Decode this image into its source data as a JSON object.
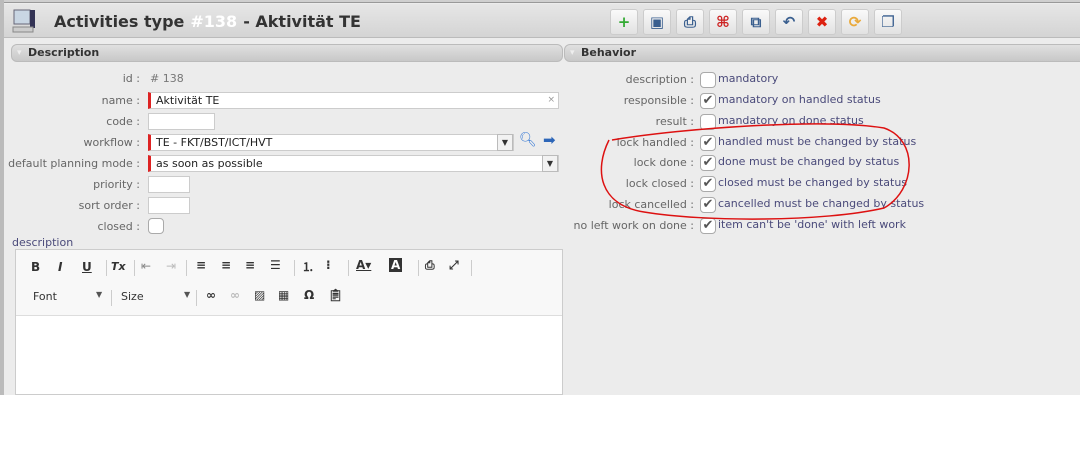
{
  "header": {
    "title": "Activities type",
    "id_label": "#138",
    "name_suffix": "- Aktivität TE"
  },
  "toolbar": [
    {
      "icon": "new-icon",
      "glyph": "+"
    },
    {
      "icon": "save-icon",
      "glyph": "▣"
    },
    {
      "icon": "print-icon",
      "glyph": "⎙"
    },
    {
      "icon": "pdf-icon",
      "glyph": "⌘"
    },
    {
      "icon": "copy-icon",
      "glyph": "⧉"
    },
    {
      "icon": "undo-icon",
      "glyph": "↶"
    },
    {
      "icon": "delete-icon",
      "glyph": "✖"
    },
    {
      "icon": "refresh-icon",
      "glyph": "⟳"
    },
    {
      "icon": "multi-window-icon",
      "glyph": "❐"
    }
  ],
  "description": {
    "section": "Description",
    "id_label": "id :",
    "id_value": "#  138",
    "name_label": "name :",
    "name_value": "Aktivität TE",
    "clear": "×",
    "code_label": "code :",
    "code_value": "",
    "workflow_label": "workflow :",
    "workflow_value": "TE - FKT/BST/ICT/HVT",
    "planning_label": "default planning mode :",
    "planning_value": "as soon as possible",
    "priority_label": "priority :",
    "sort_label": "sort order :",
    "closed_label": "closed :",
    "desc_label": "description"
  },
  "editor": {
    "font": "Font",
    "size": "Size",
    "b": "B",
    "i": "I",
    "u": "U",
    "tx": "Tx",
    "omega": "Ω"
  },
  "behavior": {
    "section": "Behavior",
    "rows": [
      {
        "label": "description :",
        "text": "mandatory",
        "checked": false
      },
      {
        "label": "responsible :",
        "text": "mandatory on handled status",
        "checked": true
      },
      {
        "label": "result :",
        "text": "mandatory on done status",
        "checked": false
      },
      {
        "label": "lock handled :",
        "text": "handled must be changed by status",
        "checked": true
      },
      {
        "label": "lock done :",
        "text": "done must be changed by status",
        "checked": true
      },
      {
        "label": "lock closed :",
        "text": "closed must be changed by status",
        "checked": true
      },
      {
        "label": "lock cancelled :",
        "text": "cancelled must be changed by status",
        "checked": true
      },
      {
        "label": "no left work on done :",
        "text": "item can't be 'done' with left work",
        "checked": true
      }
    ]
  },
  "colors": {
    "required": "#dd2222",
    "annotation": "#dd1111"
  }
}
